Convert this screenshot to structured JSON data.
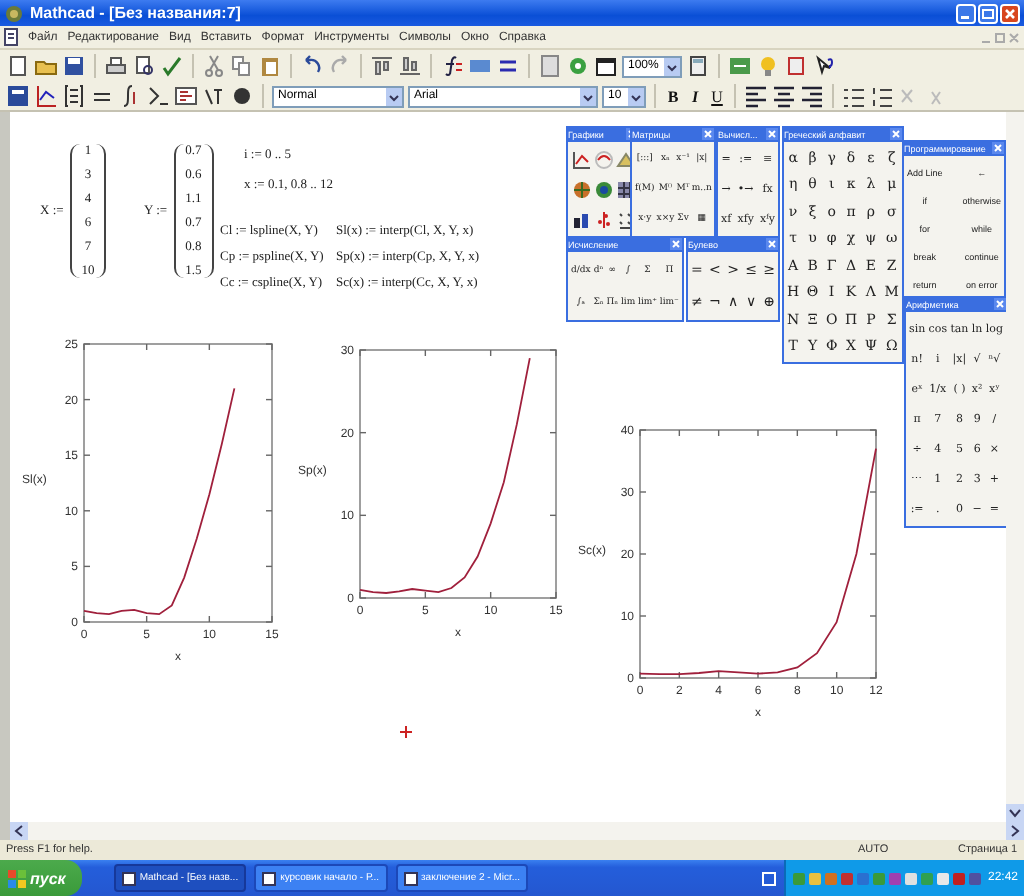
{
  "window": {
    "title": "Mathcad - [Без названия:7]"
  },
  "menu": [
    "Файл",
    "Редактирование",
    "Вид",
    "Вставить",
    "Формат",
    "Инструменты",
    "Символы",
    "Окно",
    "Справка"
  ],
  "toolbar": {
    "zoom": "100%"
  },
  "format_bar": {
    "style": "Normal",
    "font": "Arial",
    "size": "10",
    "format_buttons": [
      "B",
      "I",
      "U"
    ]
  },
  "worksheet": {
    "matrices": [
      {
        "name": "X",
        "operator": ":=",
        "values": [
          "1",
          "3",
          "4",
          "6",
          "7",
          "10"
        ]
      },
      {
        "name": "Y",
        "operator": ":=",
        "values": [
          "0.7",
          "0.6",
          "1.1",
          "0.7",
          "0.8",
          "1.5"
        ]
      }
    ],
    "range_definitions": [
      "i := 0 .. 5",
      "x := 0.1, 0.8 .. 12"
    ],
    "spline_definitions": [
      {
        "coefficients": "Cl := lspline(X, Y)",
        "function": "Sl(x) := interp(Cl, X, Y, x)"
      },
      {
        "coefficients": "Cp := pspline(X, Y)",
        "function": "Sp(x) := interp(Cp, X, Y, x)"
      },
      {
        "coefficients": "Cc := cspline(X, Y)",
        "function": "Sc(x) := interp(Cc, X, Y, x)"
      }
    ],
    "plots": [
      {
        "chart_data": {
          "type": "line",
          "xlabel": "x",
          "ylabel": "Sl(x)",
          "x": [
            0,
            1,
            2,
            3,
            4,
            5,
            6,
            7,
            8,
            9,
            10,
            11,
            12
          ],
          "xlim": [
            0,
            15
          ],
          "ylim": [
            0,
            25
          ],
          "xticks": [
            0,
            5,
            10,
            15
          ],
          "yticks": [
            0,
            5,
            10,
            15,
            20,
            25
          ],
          "series": [
            {
              "color": "#a0203c",
              "values": [
                1,
                0.8,
                0.7,
                1,
                1.1,
                0.8,
                0.7,
                1.5,
                4,
                7.5,
                11.5,
                16,
                21
              ]
            }
          ]
        }
      },
      {
        "chart_data": {
          "type": "line",
          "xlabel": "x",
          "ylabel": "Sp(x)",
          "x": [
            0,
            1,
            2,
            3,
            4,
            5,
            6,
            7,
            8,
            9,
            10,
            11,
            12,
            13
          ],
          "xlim": [
            0,
            15
          ],
          "ylim": [
            0,
            30
          ],
          "xticks": [
            0,
            5,
            10,
            15
          ],
          "yticks": [
            0,
            10,
            20,
            30
          ],
          "series": [
            {
              "color": "#a0203c",
              "values": [
                1,
                0.7,
                0.6,
                0.8,
                1.1,
                0.9,
                0.7,
                1.2,
                2.5,
                5,
                9,
                14,
                21,
                29
              ]
            }
          ]
        }
      },
      {
        "chart_data": {
          "type": "line",
          "xlabel": "x",
          "ylabel": "Sc(x)",
          "x": [
            0,
            1,
            2,
            3,
            4,
            5,
            6,
            7,
            8,
            9,
            10,
            11,
            12
          ],
          "xlim": [
            0,
            12
          ],
          "ylim": [
            0,
            40
          ],
          "xticks": [
            0,
            2,
            4,
            6,
            8,
            10,
            12
          ],
          "yticks": [
            0,
            10,
            20,
            30,
            40
          ],
          "series": [
            {
              "color": "#a0203c",
              "values": [
                0.7,
                0.6,
                0.6,
                0.8,
                1.1,
                0.9,
                0.7,
                0.9,
                1.7,
                4,
                9,
                20,
                37
              ]
            }
          ]
        }
      }
    ]
  },
  "palettes": [
    {
      "title": "Графики",
      "kind": "icons"
    },
    {
      "title": "Матрицы",
      "kind": "symbols",
      "items": [
        "[:::]",
        "xₙ",
        "x⁻¹",
        "|x|",
        "f(M)",
        "M⁽⁾",
        "Mᵀ",
        "m..n",
        "x·y",
        "x×y",
        "Σv",
        "▦"
      ]
    },
    {
      "title": "Вычисл...",
      "kind": "symbols",
      "items": [
        "=",
        ":=",
        "≡",
        "→",
        "•→",
        "fx",
        "xf",
        "xfy",
        "xᶠy"
      ]
    },
    {
      "title": "Греческий алфавит",
      "kind": "symbols",
      "items": [
        "α",
        "β",
        "γ",
        "δ",
        "ε",
        "ζ",
        "η",
        "θ",
        "ι",
        "κ",
        "λ",
        "μ",
        "ν",
        "ξ",
        "ο",
        "π",
        "ρ",
        "σ",
        "τ",
        "υ",
        "φ",
        "χ",
        "ψ",
        "ω",
        "Α",
        "Β",
        "Γ",
        "Δ",
        "Ε",
        "Ζ",
        "Η",
        "Θ",
        "Ι",
        "Κ",
        "Λ",
        "Μ",
        "Ν",
        "Ξ",
        "Ο",
        "Π",
        "Ρ",
        "Σ",
        "Τ",
        "Υ",
        "Φ",
        "Χ",
        "Ψ",
        "Ω"
      ]
    },
    {
      "title": "Программирование",
      "kind": "symbols",
      "items": [
        "Add Line",
        "←",
        "if",
        "otherwise",
        "for",
        "while",
        "break",
        "continue",
        "return",
        "on error"
      ]
    },
    {
      "title": "Исчисление",
      "kind": "symbols",
      "items": [
        "d/dx",
        "dⁿ",
        "∞",
        "∫",
        "Σ",
        "Π",
        "∫ₐ",
        "Σₙ",
        "Πₙ",
        "lim",
        "lim⁺",
        "lim⁻"
      ]
    },
    {
      "title": "Булево",
      "kind": "symbols",
      "items": [
        "=",
        "<",
        ">",
        "≤",
        "≥",
        "≠",
        "¬",
        "∧",
        "∨",
        "⊕"
      ]
    },
    {
      "title": "Арифметика",
      "kind": "symbols",
      "items": [
        "sin",
        "cos",
        "tan",
        "ln",
        "log",
        "n!",
        "i",
        "|x|",
        "√",
        "ⁿ√",
        "eˣ",
        "1/x",
        "( )",
        "x²",
        "xʸ",
        "π",
        "7",
        "8",
        "9",
        "/",
        "÷",
        "4",
        "5",
        "6",
        "×",
        "⋯",
        "1",
        "2",
        "3",
        "+",
        ":=",
        ".",
        "0",
        "−",
        "="
      ]
    }
  ],
  "status_bar": {
    "help": "Press F1 for help.",
    "mode": "AUTO",
    "page": "Страница 1"
  },
  "taskbar": {
    "start": "пуск",
    "tasks": [
      {
        "label": "Mathcad - [Без назв...",
        "selected": true
      },
      {
        "label": "курсовик начало - Р...",
        "selected": false
      },
      {
        "label": "заключение 2 - Micr...",
        "selected": false
      }
    ],
    "clock": "22:42"
  }
}
